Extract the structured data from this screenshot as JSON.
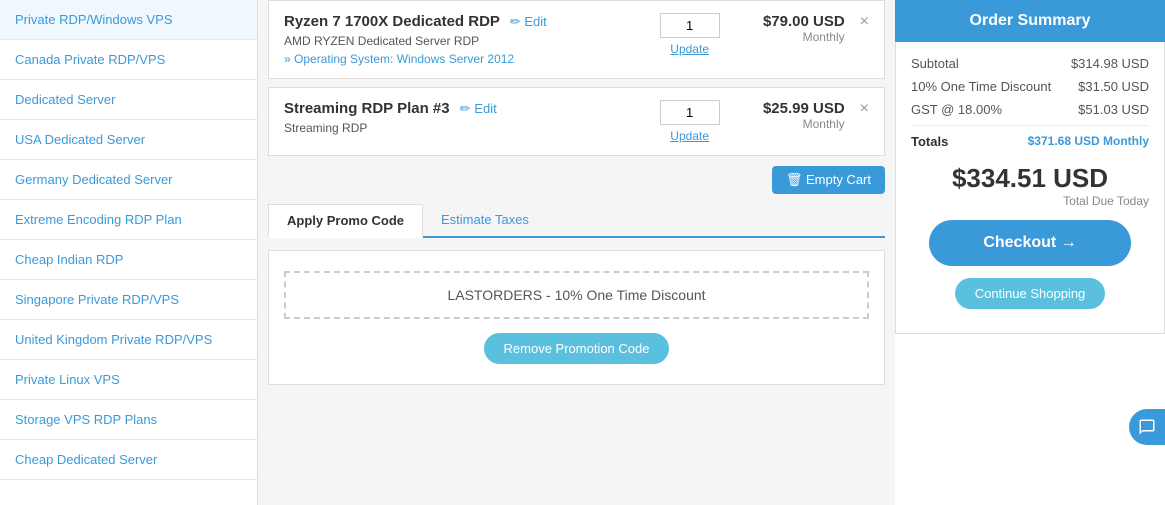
{
  "sidebar": {
    "items": [
      {
        "id": "private-rdp",
        "label": "Private RDP/Windows VPS"
      },
      {
        "id": "canada-rdp",
        "label": "Canada Private RDP/VPS"
      },
      {
        "id": "dedicated-server",
        "label": "Dedicated Server"
      },
      {
        "id": "usa-dedicated",
        "label": "USA Dedicated Server"
      },
      {
        "id": "germany-dedicated",
        "label": "Germany Dedicated Server"
      },
      {
        "id": "extreme-encoding",
        "label": "Extreme Encoding RDP Plan"
      },
      {
        "id": "cheap-indian",
        "label": "Cheap Indian RDP"
      },
      {
        "id": "singapore-rdp",
        "label": "Singapore Private RDP/VPS"
      },
      {
        "id": "uk-rdp",
        "label": "United Kingdom Private RDP/VPS"
      },
      {
        "id": "private-linux",
        "label": "Private Linux VPS"
      },
      {
        "id": "storage-vps",
        "label": "Storage VPS RDP Plans"
      },
      {
        "id": "cheap-dedicated",
        "label": "Cheap Dedicated Server"
      }
    ]
  },
  "cart": {
    "items": [
      {
        "id": "item1",
        "name": "Ryzen 7 1700X Dedicated RDP",
        "edit_label": "✏ Edit",
        "desc": "AMD RYZEN Dedicated Server RDP",
        "os": "» Operating System: Windows Server 2012",
        "qty": "1",
        "qty_update_label": "Update",
        "price": "$79.00 USD",
        "period": "Monthly"
      },
      {
        "id": "item2",
        "name": "Streaming RDP Plan #3",
        "edit_label": "✏ Edit",
        "desc": "Streaming RDP",
        "os": "",
        "qty": "1",
        "qty_update_label": "Update",
        "price": "$25.99 USD",
        "period": "Monthly"
      }
    ],
    "empty_cart_label": "🗑 Empty Cart",
    "tabs": [
      {
        "id": "promo",
        "label": "Apply Promo Code",
        "active": true
      },
      {
        "id": "taxes",
        "label": "Estimate Taxes",
        "active": false
      }
    ],
    "promo_applied_text": "LASTORDERS - 10% One Time Discount",
    "remove_promo_label": "Remove Promotion Code"
  },
  "order_summary": {
    "header": "Order Summary",
    "subtotal_label": "Subtotal",
    "subtotal_value": "$314.98 USD",
    "discount_label": "10% One Time Discount",
    "discount_value": "$31.50 USD",
    "gst_label": "GST @ 18.00%",
    "gst_value": "$51.03 USD",
    "totals_label": "Totals",
    "totals_value": "$371.68 USD Monthly",
    "total_due_amount": "$334.51 USD",
    "total_due_label": "Total Due Today",
    "checkout_label": "Checkout →",
    "continue_label": "Continue Shopping"
  }
}
